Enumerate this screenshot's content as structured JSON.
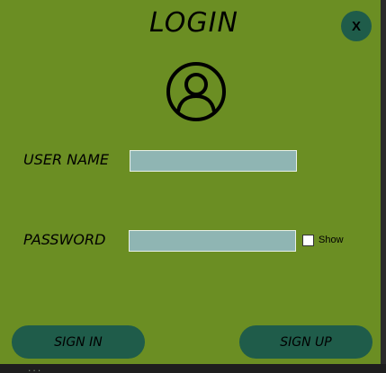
{
  "window": {
    "title": "LOGIN",
    "close_label": "X"
  },
  "form": {
    "username_label": "USER NAME",
    "username_value": "",
    "password_label": "PASSWORD",
    "password_value": "",
    "show_password_label": "Show",
    "show_password_checked": false
  },
  "actions": {
    "sign_in_label": "SIGN IN",
    "sign_up_label": "SIGN UP"
  },
  "background_text": "...",
  "colors": {
    "window_background": "#6b8e23",
    "button": "#1f5c4a",
    "field": "#8fb5b3"
  },
  "icons": {
    "user": "user-circle-icon"
  }
}
